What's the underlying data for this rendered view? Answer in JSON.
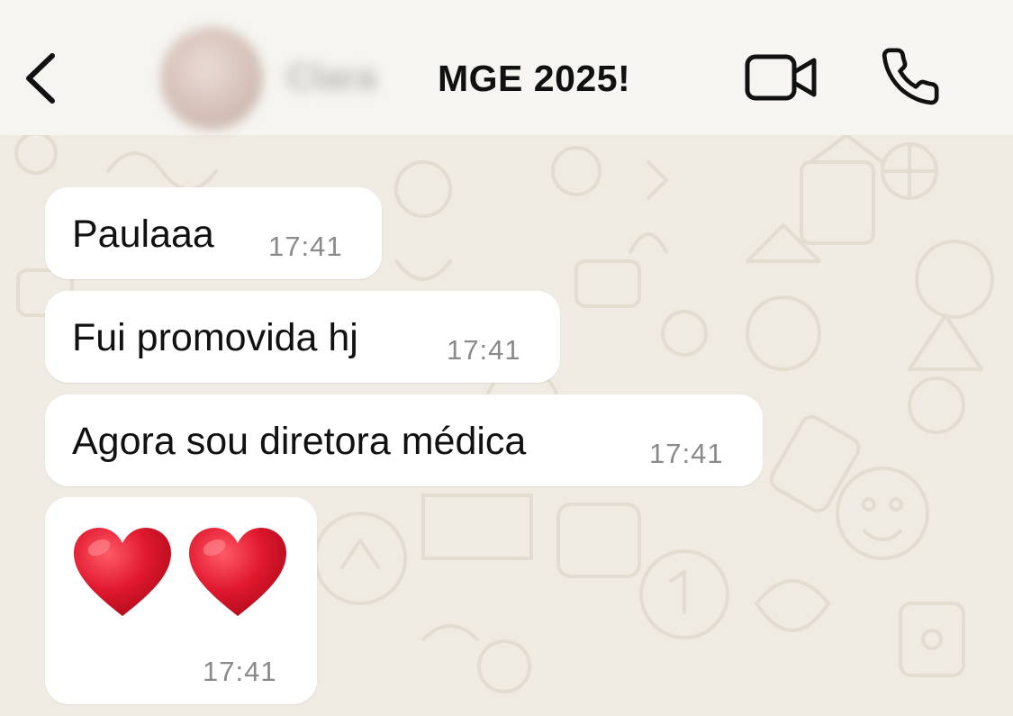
{
  "header": {
    "contact_name": "Clara",
    "title": "MGE 2025!"
  },
  "messages": [
    {
      "text": "Paulaaa",
      "time": "17:41"
    },
    {
      "text": "Fui promovida hj",
      "time": "17:41"
    },
    {
      "text": "Agora sou diretora médica",
      "time": "17:41"
    },
    {
      "emoji": [
        "heart-emoji",
        "heart-emoji"
      ],
      "time": "17:41"
    }
  ],
  "colors": {
    "header_bg": "#f6f5f1",
    "wallpaper_bg": "#efeae2",
    "doodle": "#e3dcd0",
    "bubble_bg": "#ffffff",
    "time": "#8a8a8a",
    "heart": "#e0182d"
  }
}
